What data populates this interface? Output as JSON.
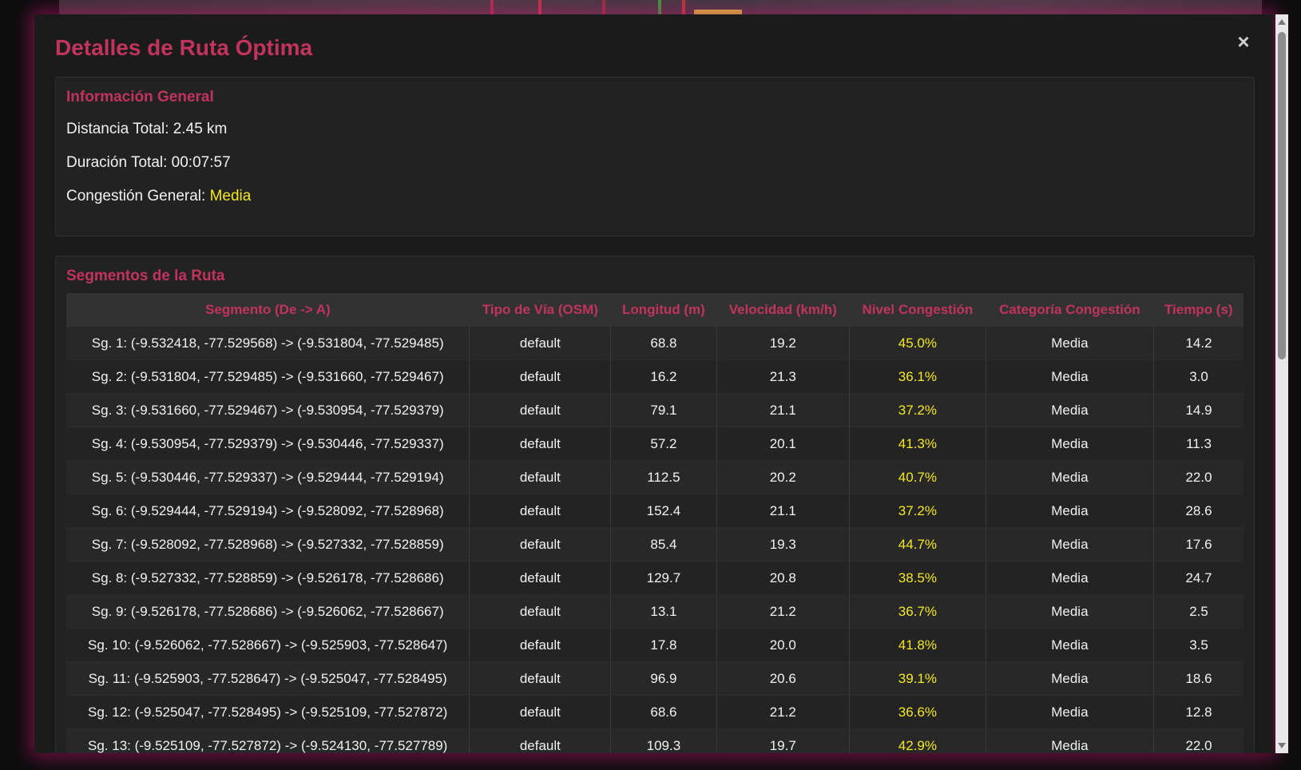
{
  "modal": {
    "title": "Detalles de Ruta Óptima",
    "close_label": "×"
  },
  "general": {
    "title": "Información General",
    "distance_label": "Distancia Total:",
    "distance_value": "2.45 km",
    "duration_label": "Duración Total:",
    "duration_value": "00:07:57",
    "congestion_label": "Congestión General:",
    "congestion_value": "Media"
  },
  "segments": {
    "title": "Segmentos de la Ruta",
    "headers": [
      "Segmento (De -> A)",
      "Tipo de Vía (OSM)",
      "Longitud (m)",
      "Velocidad (km/h)",
      "Nivel Congestión",
      "Categoría Congestión",
      "Tiempo (s)"
    ],
    "rows": [
      [
        "Sg. 1: (-9.532418, -77.529568) -> (-9.531804, -77.529485)",
        "default",
        "68.8",
        "19.2",
        "45.0%",
        "Media",
        "14.2"
      ],
      [
        "Sg. 2: (-9.531804, -77.529485) -> (-9.531660, -77.529467)",
        "default",
        "16.2",
        "21.3",
        "36.1%",
        "Media",
        "3.0"
      ],
      [
        "Sg. 3: (-9.531660, -77.529467) -> (-9.530954, -77.529379)",
        "default",
        "79.1",
        "21.1",
        "37.2%",
        "Media",
        "14.9"
      ],
      [
        "Sg. 4: (-9.530954, -77.529379) -> (-9.530446, -77.529337)",
        "default",
        "57.2",
        "20.1",
        "41.3%",
        "Media",
        "11.3"
      ],
      [
        "Sg. 5: (-9.530446, -77.529337) -> (-9.529444, -77.529194)",
        "default",
        "112.5",
        "20.2",
        "40.7%",
        "Media",
        "22.0"
      ],
      [
        "Sg. 6: (-9.529444, -77.529194) -> (-9.528092, -77.528968)",
        "default",
        "152.4",
        "21.1",
        "37.2%",
        "Media",
        "28.6"
      ],
      [
        "Sg. 7: (-9.528092, -77.528968) -> (-9.527332, -77.528859)",
        "default",
        "85.4",
        "19.3",
        "44.7%",
        "Media",
        "17.6"
      ],
      [
        "Sg. 8: (-9.527332, -77.528859) -> (-9.526178, -77.528686)",
        "default",
        "129.7",
        "20.8",
        "38.5%",
        "Media",
        "24.7"
      ],
      [
        "Sg. 9: (-9.526178, -77.528686) -> (-9.526062, -77.528667)",
        "default",
        "13.1",
        "21.2",
        "36.7%",
        "Media",
        "2.5"
      ],
      [
        "Sg. 10: (-9.526062, -77.528667) -> (-9.525903, -77.528647)",
        "default",
        "17.8",
        "20.0",
        "41.8%",
        "Media",
        "3.5"
      ],
      [
        "Sg. 11: (-9.525903, -77.528647) -> (-9.525047, -77.528495)",
        "default",
        "96.9",
        "20.6",
        "39.1%",
        "Media",
        "18.6"
      ],
      [
        "Sg. 12: (-9.525047, -77.528495) -> (-9.525109, -77.527872)",
        "default",
        "68.6",
        "21.2",
        "36.6%",
        "Media",
        "12.8"
      ],
      [
        "Sg. 13: (-9.525109, -77.527872) -> (-9.524130, -77.527789)",
        "default",
        "109.3",
        "19.7",
        "42.9%",
        "Media",
        "22.0"
      ]
    ]
  },
  "colors": {
    "accent": "#c2335e",
    "congestion_medium": "#f4e91e",
    "glow": "#be146e"
  }
}
